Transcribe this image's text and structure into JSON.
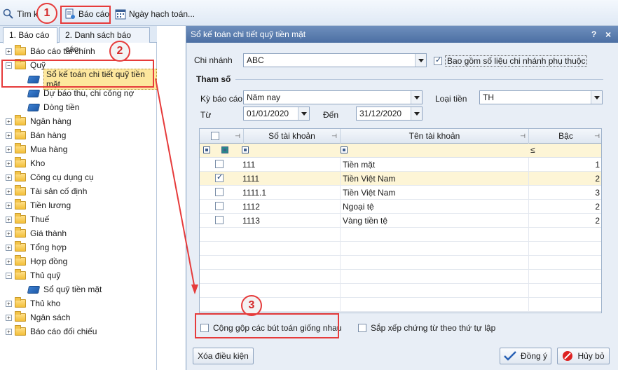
{
  "toolbar": {
    "search_label": "Tìm k",
    "report_label": "Báo cáo",
    "date_label": "Ngày hạch toán..."
  },
  "left_panel": {
    "tabs": [
      {
        "label": "1. Báo cáo",
        "active": true
      },
      {
        "label": "2. Danh sách báo cáo",
        "active": false
      }
    ],
    "tree": [
      {
        "label": "Báo cáo tài chính",
        "type": "folder",
        "expander": "+"
      },
      {
        "label": "Quỹ",
        "type": "folder",
        "expander": "-"
      },
      {
        "label": "Sổ kế toán chi tiết quỹ tiền mặt",
        "type": "report",
        "selected": true
      },
      {
        "label": "Dự báo thu, chi công nợ",
        "type": "report"
      },
      {
        "label": "Dòng tiền",
        "type": "report"
      },
      {
        "label": "Ngân hàng",
        "type": "folder",
        "expander": "+"
      },
      {
        "label": "Bán hàng",
        "type": "folder",
        "expander": "+"
      },
      {
        "label": "Mua hàng",
        "type": "folder",
        "expander": "+"
      },
      {
        "label": "Kho",
        "type": "folder",
        "expander": "+"
      },
      {
        "label": "Công cụ dụng cụ",
        "type": "folder",
        "expander": "+"
      },
      {
        "label": "Tài sản cố định",
        "type": "folder",
        "expander": "+"
      },
      {
        "label": "Tiền lương",
        "type": "folder",
        "expander": "+"
      },
      {
        "label": "Thuế",
        "type": "folder",
        "expander": "+"
      },
      {
        "label": "Giá thành",
        "type": "folder",
        "expander": "+"
      },
      {
        "label": "Tổng hợp",
        "type": "folder",
        "expander": "+"
      },
      {
        "label": "Hợp đồng",
        "type": "folder",
        "expander": "+"
      },
      {
        "label": "Thủ quỹ",
        "type": "folder",
        "expander": "-"
      },
      {
        "label": "Sổ quỹ tiền mặt",
        "type": "report"
      },
      {
        "label": "Thủ kho",
        "type": "folder",
        "expander": "+"
      },
      {
        "label": "Ngân sách",
        "type": "folder",
        "expander": "+"
      },
      {
        "label": "Báo cáo đối chiếu",
        "type": "folder",
        "expander": "+"
      }
    ]
  },
  "dialog": {
    "title": "Sổ kế toán chi tiết quỹ tiền mặt",
    "help": "?",
    "close": "×",
    "branch_label": "Chi nhánh",
    "branch_value": "ABC",
    "include_branch_label": "Bao gồm số liệu chi nhánh phụ thuộc",
    "include_branch_checked": true,
    "params_title": "Tham số",
    "period_label": "Kỳ báo cáo",
    "period_value": "Năm nay",
    "currency_label": "Loại tiền",
    "currency_value": "TH",
    "from_label": "Từ",
    "from_value": "01/01/2020",
    "to_label": "Đến",
    "to_value": "31/12/2020",
    "grid": {
      "headers": [
        "Số tài khoản",
        "Tên tài khoản",
        "Bậc"
      ],
      "filter_level": "≤",
      "rows": [
        {
          "account": "111",
          "name": "Tiền mặt",
          "level": "1",
          "checked": false
        },
        {
          "account": "1111",
          "name": "Tiền Việt Nam",
          "level": "2",
          "checked": true
        },
        {
          "account": "1111.1",
          "name": "Tiền Việt Nam",
          "level": "3",
          "checked": false
        },
        {
          "account": "1112",
          "name": "Ngoại tệ",
          "level": "2",
          "checked": false
        },
        {
          "account": "1113",
          "name": "Vàng tiền tệ",
          "level": "2",
          "checked": false
        }
      ]
    },
    "merge_label": "Cộng gộp các bút toán giống nhau",
    "sort_label": "Sắp xếp chứng từ theo thứ tự lập",
    "clear_button": "Xóa điều kiện",
    "ok_button": "Đồng ý",
    "cancel_button": "Hủy bỏ"
  },
  "callouts": [
    "1",
    "2",
    "3"
  ],
  "colors": {
    "highlight": "#e63b3b",
    "title_bar": "#5a7cb0"
  }
}
